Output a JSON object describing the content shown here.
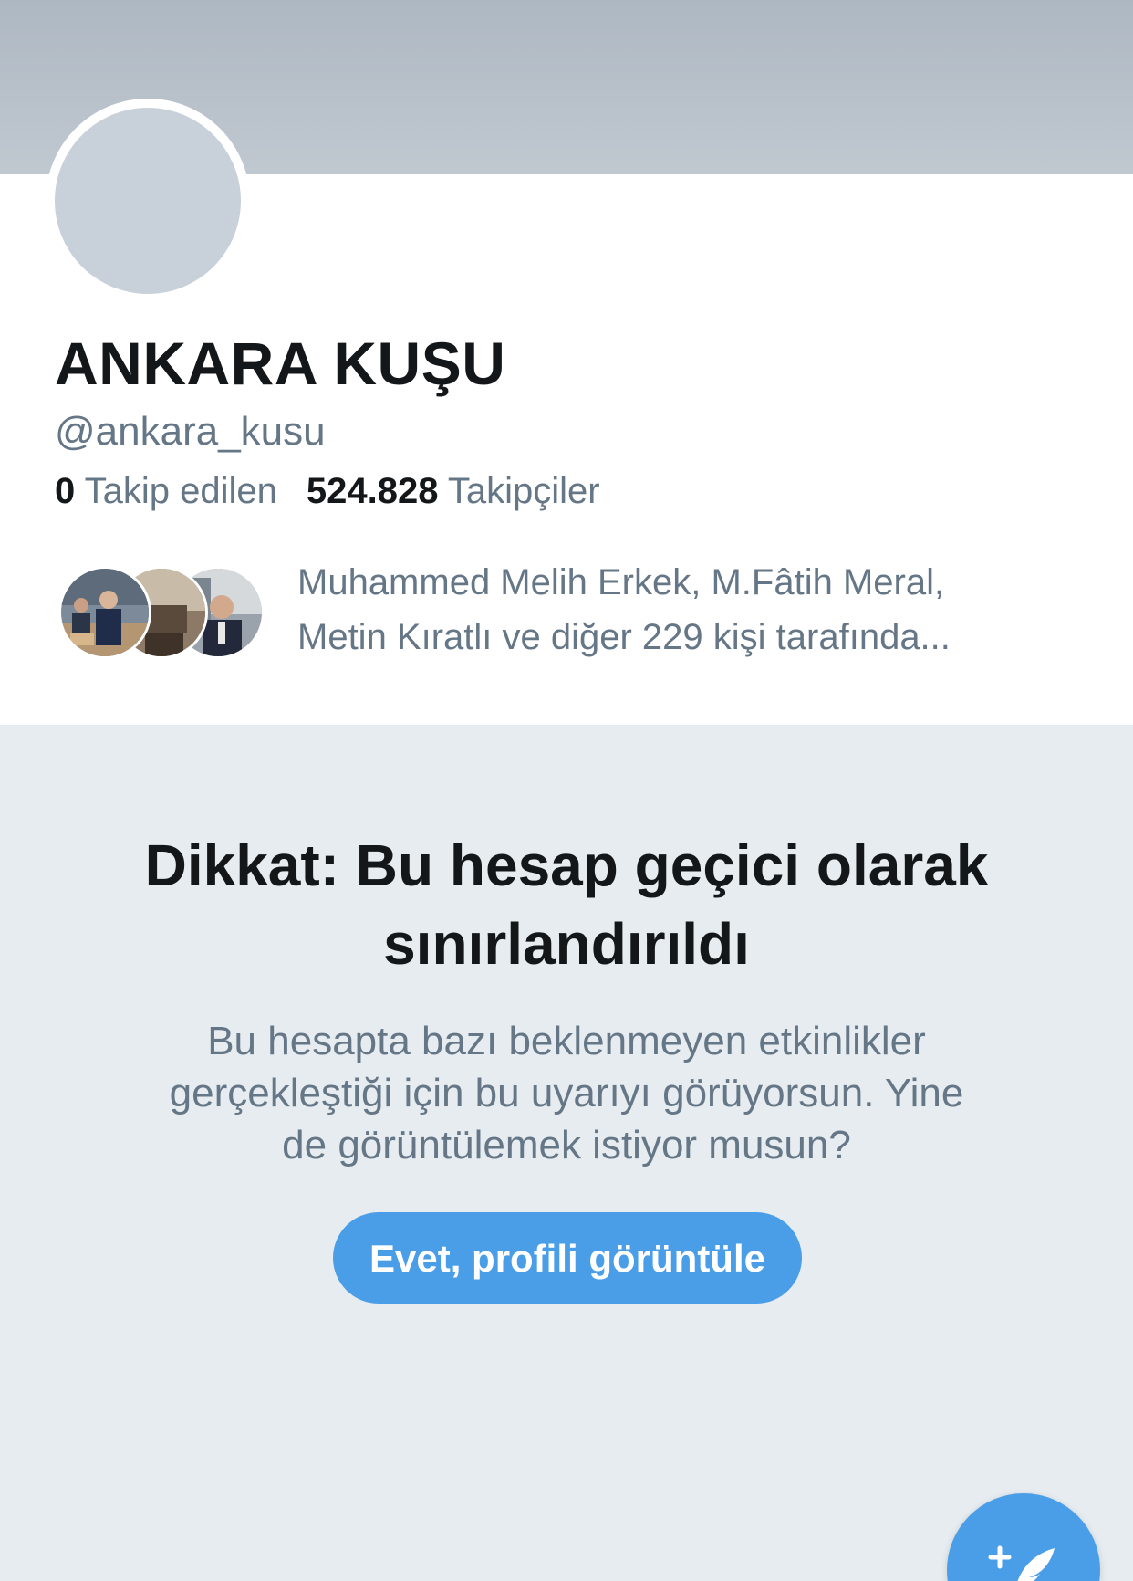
{
  "profile": {
    "display_name": "ANKARA KUŞU",
    "handle": "@ankara_kusu",
    "following_count": "0",
    "following_label": "Takip edilen",
    "followers_count": "524.828",
    "followers_label": "Takipçiler",
    "followed_by_line1": "Muhammed Melih Erkek, M.Fâtih Meral,",
    "followed_by_line2": "Metin Kıratlı ve diğer 229 kişi tarafında..."
  },
  "warning": {
    "title_line1": "Dikkat: Bu hesap geçici olarak",
    "title_line2": "sınırlandırıldı",
    "body_line1": "Bu hesapta bazı beklenmeyen etkinlikler",
    "body_line2": "gerçekleştiği için bu uyarıyı görüyorsun. Yine",
    "body_line3": "de görüntülemek istiyor musun?",
    "button_label": "Evet, profili görüntüle"
  },
  "fab": {
    "icon": "compose-tweet-icon"
  },
  "colors": {
    "accent": "#4a9ee8",
    "text_primary": "#14171a",
    "text_secondary": "#657786",
    "background": "#e6ecf0"
  }
}
